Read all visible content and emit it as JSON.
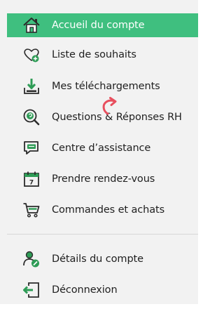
{
  "menu": {
    "items": [
      {
        "label": "Accueil du compte",
        "icon": "house-icon"
      },
      {
        "label": "Liste de souhaits",
        "icon": "heart-add-icon"
      },
      {
        "label": "Mes téléchargements",
        "icon": "download-tray-icon"
      },
      {
        "label": "Questions & Réponses RH",
        "icon": "magnifier-qa-icon"
      },
      {
        "label": "Centre d’assistance",
        "icon": "chat-bubbles-icon"
      },
      {
        "label": "Prendre rendez-vous",
        "icon": "calendar-icon"
      },
      {
        "label": "Commandes et achats",
        "icon": "shopping-cart-icon"
      },
      {
        "label": "Détails du compte",
        "icon": "user-edit-icon"
      },
      {
        "label": "Déconnexion",
        "icon": "logout-icon"
      }
    ],
    "active_index": 0
  },
  "calendar_day": "7",
  "colors": {
    "accent": "#3fbf7f",
    "icon_green": "#2e9c56",
    "icon_outline": "#2b2b2b",
    "annotation_arrow": "#e84f5e"
  }
}
